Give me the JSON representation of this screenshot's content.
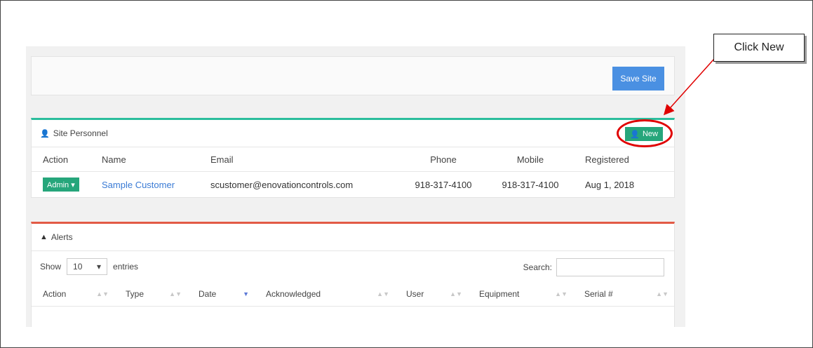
{
  "save_site": {
    "label": "Save Site"
  },
  "personnel": {
    "title": "Site Personnel",
    "new_label": "New",
    "columns": [
      "Action",
      "Name",
      "Email",
      "Phone",
      "Mobile",
      "Registered"
    ],
    "rows": [
      {
        "action": "Admin",
        "name": "Sample Customer",
        "email": "scustomer@enovationcontrols.com",
        "phone": "918-317-4100",
        "mobile": "918-317-4100",
        "registered": "Aug 1, 2018"
      }
    ]
  },
  "alerts": {
    "title": "Alerts",
    "show_label": "Show",
    "entries_value": "10",
    "entries_label": "entries",
    "search_label": "Search:",
    "columns": [
      "Action",
      "Type",
      "Date",
      "Acknowledged",
      "User",
      "Equipment",
      "Serial #"
    ]
  },
  "callout": {
    "text": "Click New"
  },
  "icons": {
    "person": "user-icon",
    "warning": "warning-icon",
    "caret": "caret-down-icon"
  },
  "colors": {
    "personnel_accent": "#2bbd9c",
    "alerts_accent": "#e25a45",
    "primary_button": "#4a90e2",
    "success_button": "#26a67b",
    "annotation": "#e00000"
  }
}
